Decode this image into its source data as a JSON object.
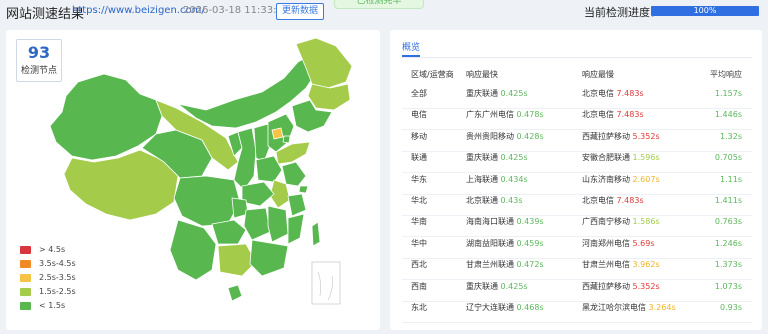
{
  "header": {
    "title": "网站测速结果",
    "url": "https://www.beizigen.com/",
    "timestamp": "2026-03-18 11:33:49",
    "refresh_label": "更新数据",
    "status_text": "已检测完毕",
    "progress_label": "当前检测进度：",
    "progress_value": 1.0,
    "progress_text": "100%"
  },
  "map_panel": {
    "node_count": "93",
    "node_count_label": "检测节点",
    "legend": [
      {
        "label": "> 4.5s",
        "color": "#d9363e"
      },
      {
        "label": "3.5s-4.5s",
        "color": "#f08a24"
      },
      {
        "label": "2.5s-3.5s",
        "color": "#f6c445"
      },
      {
        "label": "1.5s-2.5s",
        "color": "#a4cc4a"
      },
      {
        "label": "< 1.5s",
        "color": "#58b84f"
      }
    ]
  },
  "table": {
    "tab_label": "概览",
    "columns": {
      "region": "区域/运营商",
      "fastest": "响应最快",
      "slowest": "响应最慢",
      "average": "平均响应"
    },
    "rows": [
      {
        "region": "全部",
        "fast_node": "重庆联通",
        "fast_time": "0.425s",
        "fast_color": "#5cb85c",
        "slow_node": "北京电信",
        "slow_time": "7.483s",
        "slow_color": "#e23a3a",
        "avg": "1.157s",
        "avg_color": "#5cb85c"
      },
      {
        "region": "电信",
        "fast_node": "广东广州电信",
        "fast_time": "0.478s",
        "fast_color": "#5cb85c",
        "slow_node": "北京电信",
        "slow_time": "7.483s",
        "slow_color": "#e23a3a",
        "avg": "1.446s",
        "avg_color": "#5cb85c"
      },
      {
        "region": "移动",
        "fast_node": "贵州贵阳移动",
        "fast_time": "0.428s",
        "fast_color": "#5cb85c",
        "slow_node": "西藏拉萨移动",
        "slow_time": "5.352s",
        "slow_color": "#e23a3a",
        "avg": "1.32s",
        "avg_color": "#5cb85c"
      },
      {
        "region": "联通",
        "fast_node": "重庆联通",
        "fast_time": "0.425s",
        "fast_color": "#5cb85c",
        "slow_node": "安徽合肥联通",
        "slow_time": "1.596s",
        "slow_color": "#a4cc4a",
        "avg": "0.705s",
        "avg_color": "#5cb85c"
      },
      {
        "region": "华东",
        "fast_node": "上海联通",
        "fast_time": "0.434s",
        "fast_color": "#5cb85c",
        "slow_node": "山东济南移动",
        "slow_time": "2.607s",
        "slow_color": "#f0b429",
        "avg": "1.11s",
        "avg_color": "#5cb85c"
      },
      {
        "region": "华北",
        "fast_node": "北京联通",
        "fast_time": "0.43s",
        "fast_color": "#5cb85c",
        "slow_node": "北京电信",
        "slow_time": "7.483s",
        "slow_color": "#e23a3a",
        "avg": "1.411s",
        "avg_color": "#5cb85c"
      },
      {
        "region": "华南",
        "fast_node": "海南海口联通",
        "fast_time": "0.439s",
        "fast_color": "#5cb85c",
        "slow_node": "广西南宁移动",
        "slow_time": "1.586s",
        "slow_color": "#a4cc4a",
        "avg": "0.763s",
        "avg_color": "#5cb85c"
      },
      {
        "region": "华中",
        "fast_node": "湖南益阳联通",
        "fast_time": "0.459s",
        "fast_color": "#5cb85c",
        "slow_node": "河南郑州电信",
        "slow_time": "5.69s",
        "slow_color": "#e23a3a",
        "avg": "1.246s",
        "avg_color": "#5cb85c"
      },
      {
        "region": "西北",
        "fast_node": "甘肃兰州联通",
        "fast_time": "0.472s",
        "fast_color": "#5cb85c",
        "slow_node": "甘肃兰州电信",
        "slow_time": "3.962s",
        "slow_color": "#f0b429",
        "avg": "1.373s",
        "avg_color": "#5cb85c"
      },
      {
        "region": "西南",
        "fast_node": "重庆联通",
        "fast_time": "0.425s",
        "fast_color": "#5cb85c",
        "slow_node": "西藏拉萨移动",
        "slow_time": "5.352s",
        "slow_color": "#e23a3a",
        "avg": "1.073s",
        "avg_color": "#5cb85c"
      },
      {
        "region": "东北",
        "fast_node": "辽宁大连联通",
        "fast_time": "0.468s",
        "fast_color": "#5cb85c",
        "slow_node": "黑龙江哈尔滨电信",
        "slow_time": "3.264s",
        "slow_color": "#f0b429",
        "avg": "0.93s",
        "avg_color": "#5cb85c"
      }
    ]
  }
}
